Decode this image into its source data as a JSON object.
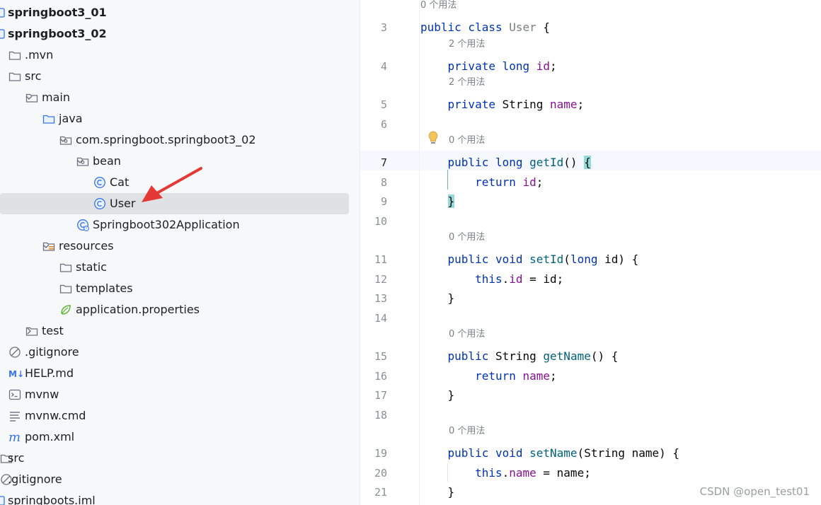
{
  "project_tree": {
    "items": [
      {
        "label": "springboot3_01",
        "icon": "module-icon",
        "depth": 0,
        "bold": true,
        "expanded": null,
        "selected": false
      },
      {
        "label": "springboot3_02",
        "icon": "module-icon",
        "depth": 0,
        "bold": true,
        "expanded": null,
        "selected": false
      },
      {
        "label": ".mvn",
        "icon": "folder-icon",
        "depth": 1,
        "bold": false,
        "expanded": null,
        "selected": false
      },
      {
        "label": "src",
        "icon": "folder-icon",
        "depth": 1,
        "bold": false,
        "expanded": null,
        "selected": false
      },
      {
        "label": "main",
        "icon": "folder-icon",
        "depth": 2,
        "bold": false,
        "expanded": true,
        "selected": false
      },
      {
        "label": "java",
        "icon": "source-folder-icon",
        "depth": 3,
        "bold": false,
        "expanded": true,
        "selected": false
      },
      {
        "label": "com.springboot.springboot3_02",
        "icon": "package-icon",
        "depth": 4,
        "bold": false,
        "expanded": true,
        "selected": false
      },
      {
        "label": "bean",
        "icon": "package-icon",
        "depth": 5,
        "bold": false,
        "expanded": true,
        "selected": false
      },
      {
        "label": "Cat",
        "icon": "class-icon",
        "depth": 6,
        "bold": false,
        "expanded": null,
        "selected": false
      },
      {
        "label": "User",
        "icon": "class-icon",
        "depth": 6,
        "bold": false,
        "expanded": null,
        "selected": true
      },
      {
        "label": "Springboot302Application",
        "icon": "spring-boot-class-icon",
        "depth": 5,
        "bold": false,
        "expanded": null,
        "selected": false
      },
      {
        "label": "resources",
        "icon": "resources-folder-icon",
        "depth": 3,
        "bold": false,
        "expanded": true,
        "selected": false
      },
      {
        "label": "static",
        "icon": "folder-icon",
        "depth": 4,
        "bold": false,
        "expanded": null,
        "selected": false
      },
      {
        "label": "templates",
        "icon": "folder-icon",
        "depth": 4,
        "bold": false,
        "expanded": null,
        "selected": false
      },
      {
        "label": "application.properties",
        "icon": "spring-properties-icon",
        "depth": 4,
        "bold": false,
        "expanded": null,
        "selected": false
      },
      {
        "label": "test",
        "icon": "folder-icon",
        "depth": 2,
        "bold": false,
        "expanded": false,
        "selected": false
      },
      {
        "label": ".gitignore",
        "icon": "ignore-file-icon",
        "depth": 1,
        "bold": false,
        "expanded": null,
        "selected": false
      },
      {
        "label": "HELP.md",
        "icon": "markdown-icon",
        "depth": 1,
        "bold": false,
        "expanded": null,
        "selected": false
      },
      {
        "label": "mvnw",
        "icon": "terminal-file-icon",
        "depth": 1,
        "bold": false,
        "expanded": null,
        "selected": false
      },
      {
        "label": "mvnw.cmd",
        "icon": "text-file-icon",
        "depth": 1,
        "bold": false,
        "expanded": null,
        "selected": false
      },
      {
        "label": "pom.xml",
        "icon": "maven-icon",
        "depth": 1,
        "bold": false,
        "expanded": null,
        "selected": false
      },
      {
        "label": "src",
        "icon": "folder-icon",
        "depth": 0,
        "bold": false,
        "expanded": null,
        "selected": false
      },
      {
        "label": ".gitignore",
        "icon": "ignore-file-icon",
        "depth": 0,
        "bold": false,
        "expanded": null,
        "selected": false
      },
      {
        "label": "springboots.iml",
        "icon": "module-file-icon",
        "depth": 0,
        "bold": false,
        "expanded": null,
        "selected": false
      }
    ]
  },
  "editor": {
    "current_line": "7",
    "lines": [
      {
        "kind": "hint",
        "text": "0 个用法"
      },
      {
        "kind": "code",
        "num": "3",
        "tokens": [
          [
            "k",
            "public class "
          ],
          [
            "d",
            "User"
          ],
          [
            "p",
            " {"
          ]
        ]
      },
      {
        "kind": "hint",
        "text": "2 个用法"
      },
      {
        "kind": "code",
        "num": "4",
        "tokens": [
          [
            "p",
            "    "
          ],
          [
            "k",
            "private long "
          ],
          [
            "f",
            "id"
          ],
          [
            "p",
            ";"
          ]
        ]
      },
      {
        "kind": "hint",
        "text": "2 个用法"
      },
      {
        "kind": "code",
        "num": "5",
        "tokens": [
          [
            "p",
            "    "
          ],
          [
            "k",
            "private "
          ],
          [
            "p",
            "String "
          ],
          [
            "f",
            "name"
          ],
          [
            "p",
            ";"
          ]
        ]
      },
      {
        "kind": "code",
        "num": "6",
        "tokens": []
      },
      {
        "kind": "hint",
        "text": "0 个用法",
        "bulb": true
      },
      {
        "kind": "code",
        "num": "7",
        "tokens": [
          [
            "p",
            "    "
          ],
          [
            "k",
            "public long "
          ],
          [
            "m",
            "getId"
          ],
          [
            "p",
            "() "
          ],
          [
            "b",
            "{"
          ]
        ]
      },
      {
        "kind": "code",
        "num": "8",
        "tokens": [
          [
            "p",
            "        "
          ],
          [
            "k",
            "return "
          ],
          [
            "f",
            "id"
          ],
          [
            "p",
            ";"
          ]
        ]
      },
      {
        "kind": "code",
        "num": "9",
        "tokens": [
          [
            "p",
            "    "
          ],
          [
            "b",
            "}"
          ]
        ]
      },
      {
        "kind": "code",
        "num": "10",
        "tokens": []
      },
      {
        "kind": "hint",
        "text": "0 个用法"
      },
      {
        "kind": "code",
        "num": "11",
        "tokens": [
          [
            "p",
            "    "
          ],
          [
            "k",
            "public void "
          ],
          [
            "m",
            "setId"
          ],
          [
            "p",
            "("
          ],
          [
            "k",
            "long "
          ],
          [
            "p",
            "id) {"
          ]
        ]
      },
      {
        "kind": "code",
        "num": "12",
        "tokens": [
          [
            "p",
            "        "
          ],
          [
            "k",
            "this"
          ],
          [
            "p",
            "."
          ],
          [
            "f",
            "id"
          ],
          [
            "p",
            " = id;"
          ]
        ]
      },
      {
        "kind": "code",
        "num": "13",
        "tokens": [
          [
            "p",
            "    }"
          ]
        ]
      },
      {
        "kind": "code",
        "num": "14",
        "tokens": []
      },
      {
        "kind": "hint",
        "text": "0 个用法"
      },
      {
        "kind": "code",
        "num": "15",
        "tokens": [
          [
            "p",
            "    "
          ],
          [
            "k",
            "public "
          ],
          [
            "p",
            "String "
          ],
          [
            "m",
            "getName"
          ],
          [
            "p",
            "() {"
          ]
        ]
      },
      {
        "kind": "code",
        "num": "16",
        "tokens": [
          [
            "p",
            "        "
          ],
          [
            "k",
            "return "
          ],
          [
            "f",
            "name"
          ],
          [
            "p",
            ";"
          ]
        ]
      },
      {
        "kind": "code",
        "num": "17",
        "tokens": [
          [
            "p",
            "    }"
          ]
        ]
      },
      {
        "kind": "code",
        "num": "18",
        "tokens": []
      },
      {
        "kind": "hint",
        "text": "0 个用法"
      },
      {
        "kind": "code",
        "num": "19",
        "tokens": [
          [
            "p",
            "    "
          ],
          [
            "k",
            "public void "
          ],
          [
            "m",
            "setName"
          ],
          [
            "p",
            "(String name) {"
          ]
        ]
      },
      {
        "kind": "code",
        "num": "20",
        "tokens": [
          [
            "p",
            "        "
          ],
          [
            "k",
            "this"
          ],
          [
            "p",
            "."
          ],
          [
            "f",
            "name"
          ],
          [
            "p",
            " = name;"
          ]
        ]
      },
      {
        "kind": "code",
        "num": "21",
        "tokens": [
          [
            "p",
            "    }"
          ]
        ]
      }
    ]
  },
  "watermark": "CSDN @open_test01",
  "colors": {
    "keyword": "#0033b3",
    "field": "#871094",
    "method": "#00627a",
    "selection": "#dfe1e5",
    "annotation_arrow": "#e53935"
  }
}
